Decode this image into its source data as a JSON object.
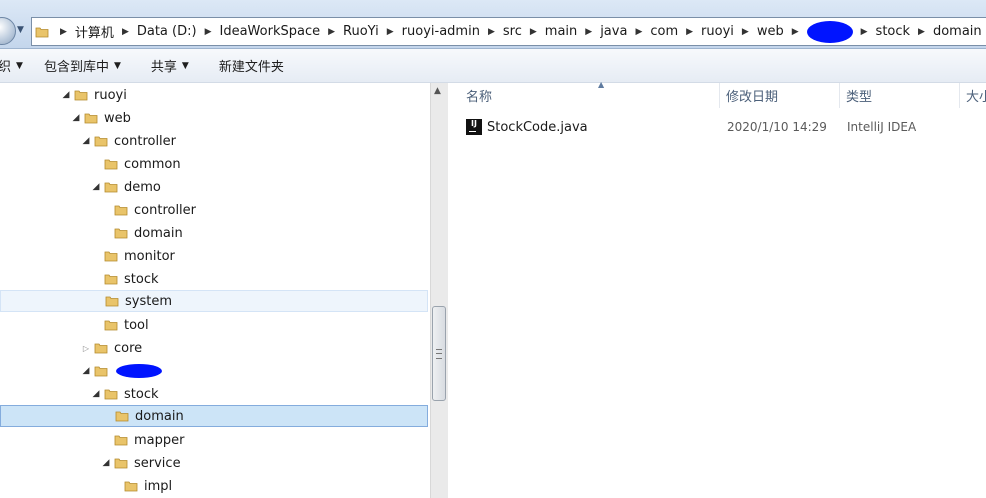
{
  "address_bar": {
    "segments": [
      "计算机",
      "Data (D:)",
      "IdeaWorkSpace",
      "RuoYi",
      "ruoyi-admin",
      "src",
      "main",
      "java",
      "com",
      "ruoyi",
      "web"
    ],
    "segments_after_redaction": [
      "stock",
      "domain"
    ]
  },
  "toolbar": {
    "cut_off_label": "织",
    "include_in_library": "包含到库中",
    "share": "共享",
    "new_folder": "新建文件夹"
  },
  "tree": {
    "items": [
      {
        "label": "ruoyi",
        "expanded": true
      },
      {
        "label": "web",
        "expanded": true
      },
      {
        "label": "controller",
        "expanded": true
      },
      {
        "label": "common"
      },
      {
        "label": "demo",
        "expanded": true
      },
      {
        "label": "controller"
      },
      {
        "label": "domain"
      },
      {
        "label": "monitor"
      },
      {
        "label": "stock"
      },
      {
        "label": "system",
        "hover": true
      },
      {
        "label": "tool"
      },
      {
        "label": "core",
        "expanded": false
      },
      {
        "label": "",
        "redacted": true,
        "expanded": true
      },
      {
        "label": "stock",
        "expanded": true
      },
      {
        "label": "domain",
        "selected": true
      },
      {
        "label": "mapper"
      },
      {
        "label": "service",
        "expanded": true
      },
      {
        "label": "impl"
      }
    ]
  },
  "list": {
    "columns": [
      "名称",
      "修改日期",
      "类型",
      "大小"
    ],
    "files": [
      {
        "name": "StockCode.java",
        "modified": "2020/1/10 14:29",
        "type": "IntelliJ IDEA",
        "icon_text": "IJ"
      }
    ]
  },
  "colors": {
    "selection": "#cce4f7",
    "redaction": "#0014ff",
    "folder": "#e9c46a"
  }
}
